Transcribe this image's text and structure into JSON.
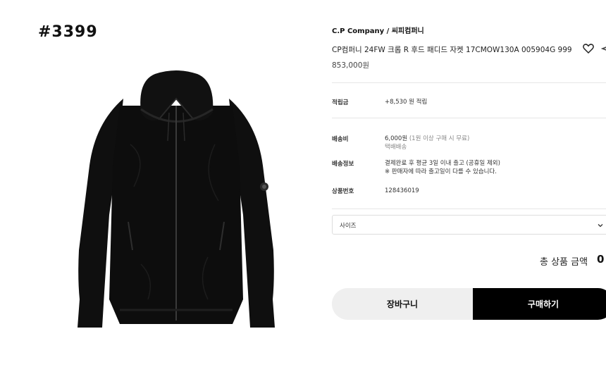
{
  "product_number": "#3399",
  "brand": "C.P Company / 씨피컴퍼니",
  "title": "CP컴퍼니 24FW 크롭 R 후드 패디드 자켓 17CMOW130A 005904G 999",
  "price": "853,000원",
  "icons": {
    "wishlist": "heart-icon",
    "share": "share-icon",
    "dropdown": "chevron-down-icon"
  },
  "details": {
    "points": {
      "label": "적립금",
      "value": "+8,530 원 적립"
    },
    "shipping": {
      "label": "배송비",
      "fee": "6,000원",
      "fee_note": "(1원 이상 구매 시 무료)",
      "method": "택배배송"
    },
    "delivery_info": {
      "label": "배송정보",
      "line1": "결제완료 후 평균 3일 이내 출고 (공휴일 제외)",
      "line2": "※ 판매자에 따라 출고일이 다를 수 있습니다."
    },
    "product_code": {
      "label": "상품번호",
      "value": "128436019"
    }
  },
  "size_select": {
    "placeholder": "사이즈"
  },
  "total": {
    "label": "총 상품 금액",
    "value": "0"
  },
  "buttons": {
    "cart": "장바구니",
    "buy": "구매하기"
  },
  "colors": {
    "buy_button": "#000000",
    "cart_button": "#efefef",
    "jacket": "#0d0d0d"
  }
}
